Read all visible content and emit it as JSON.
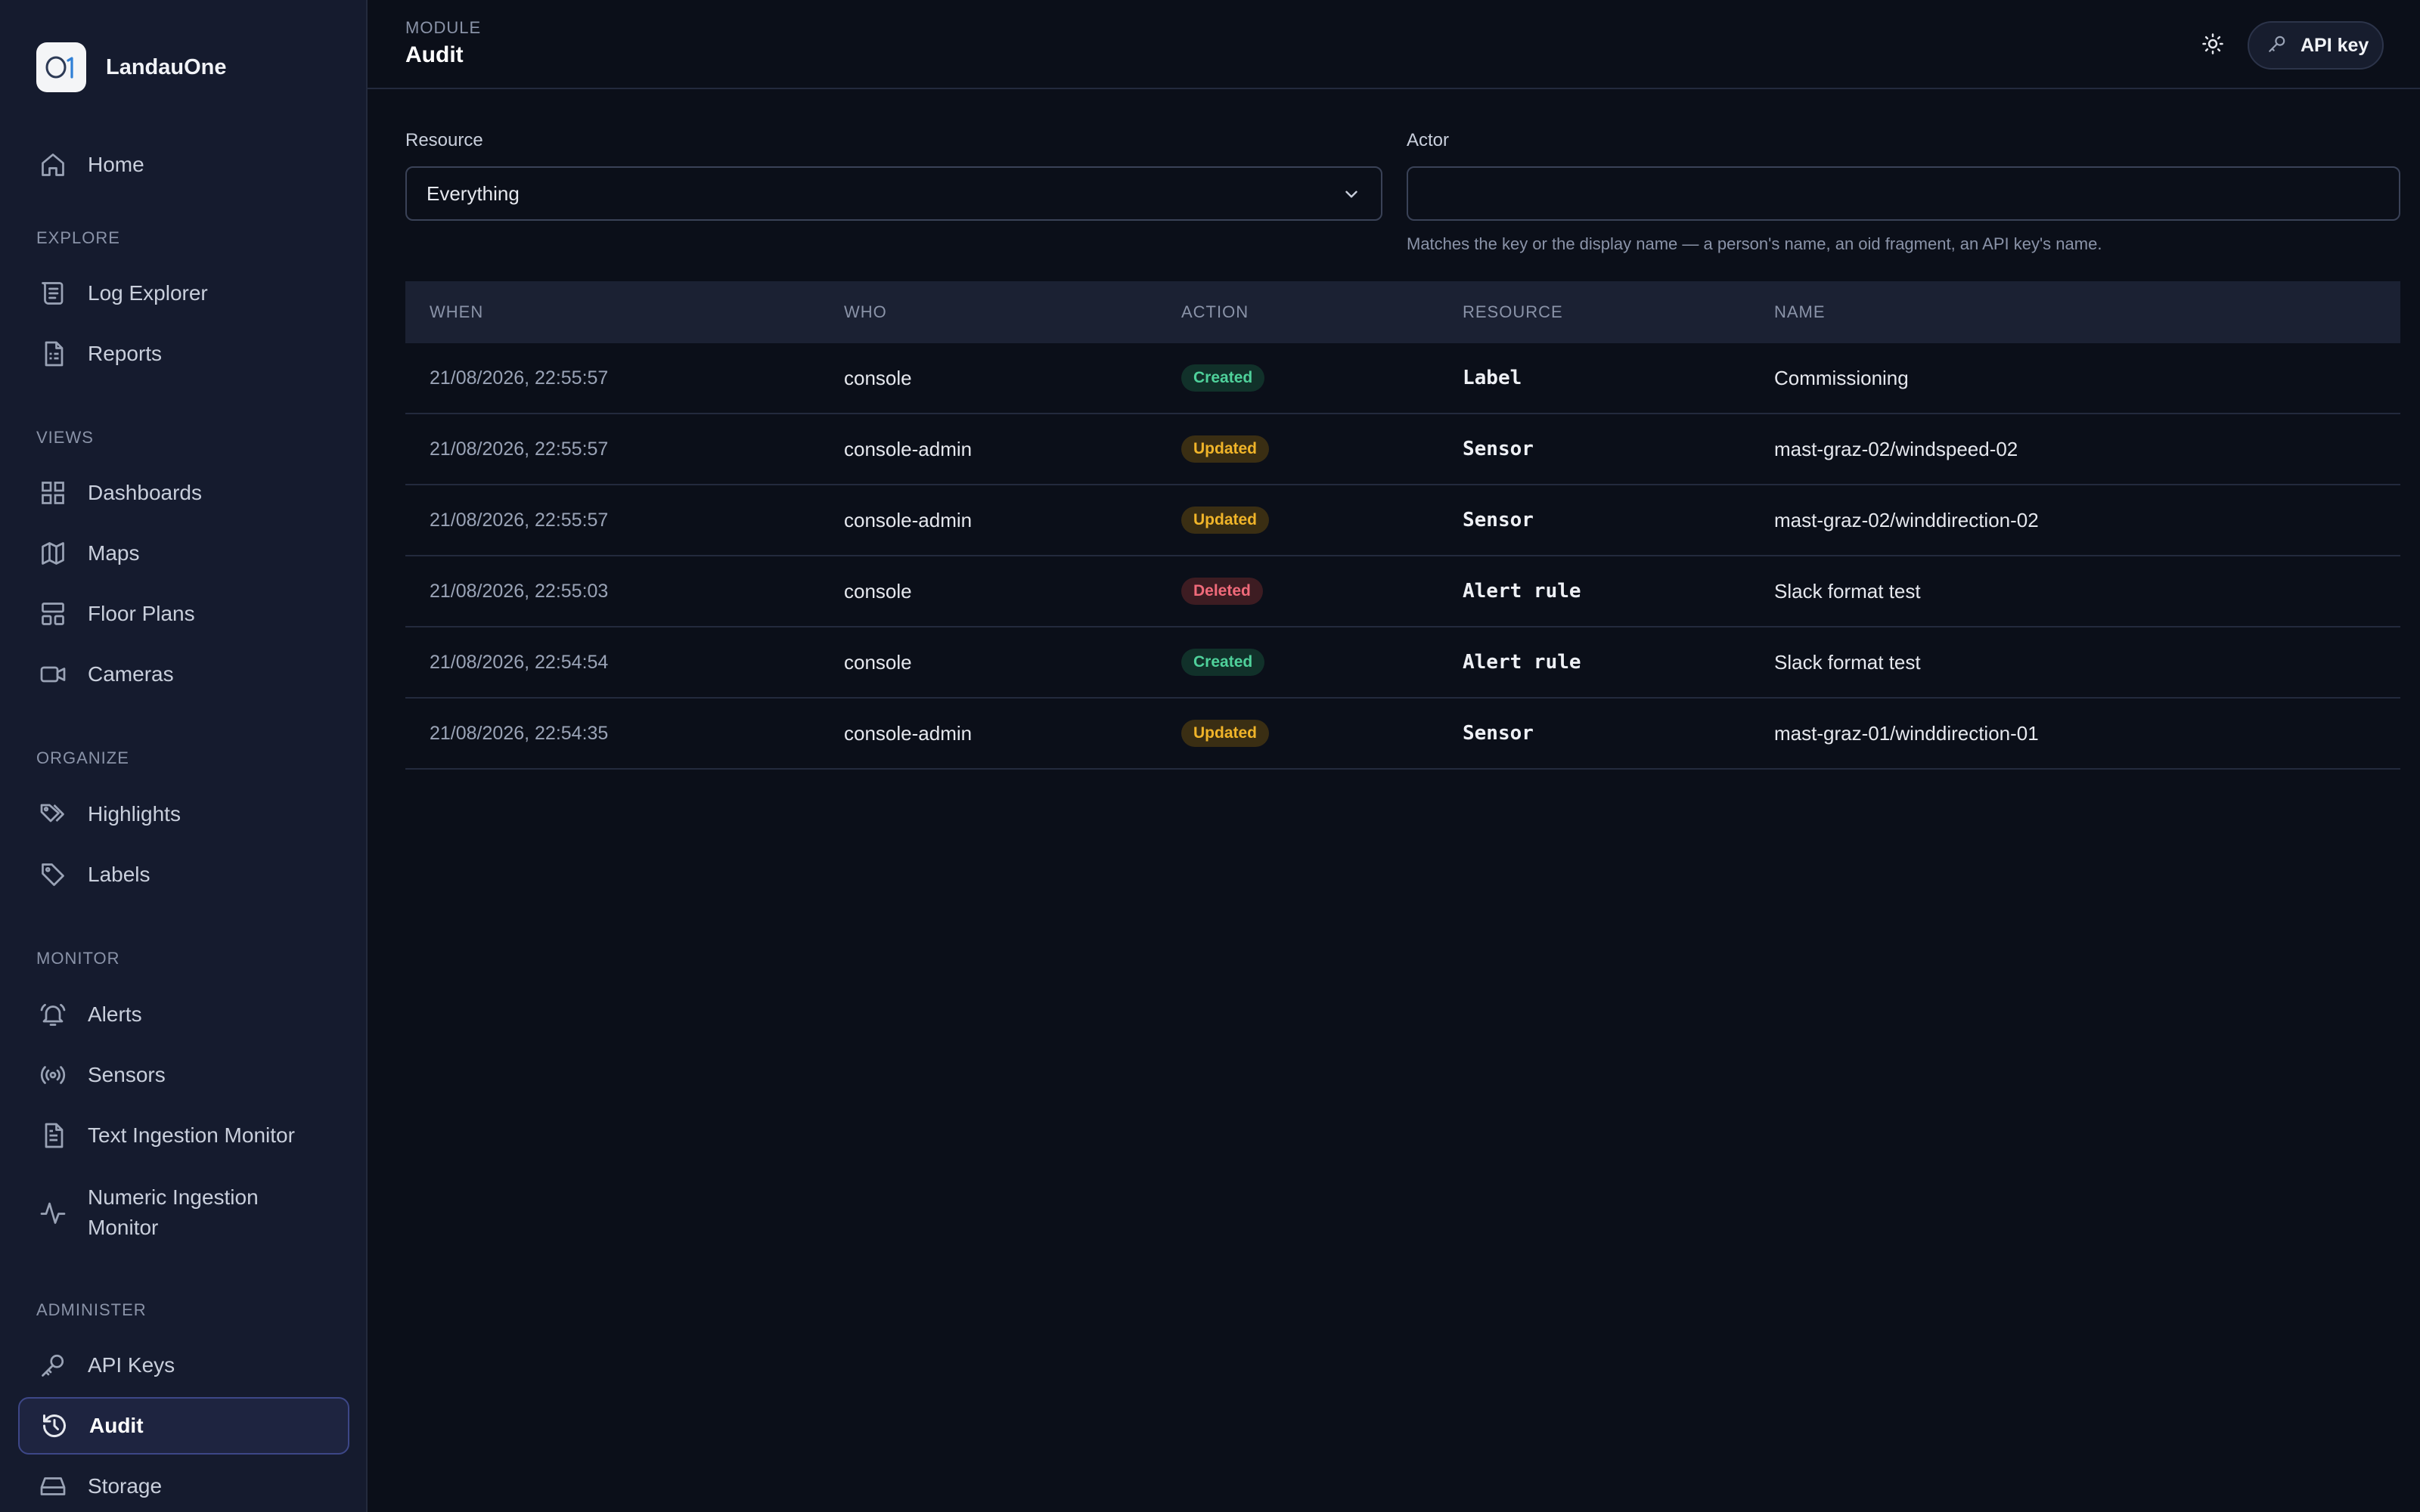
{
  "app": {
    "name": "LandauOne",
    "logo_text": "O1"
  },
  "header": {
    "module_label": "MODULE",
    "title": "Audit",
    "api_key_button": "API key"
  },
  "sidebar": {
    "home": "Home",
    "sections": {
      "explore": "EXPLORE",
      "views": "VIEWS",
      "organize": "ORGANIZE",
      "monitor": "MONITOR",
      "administer": "ADMINISTER"
    },
    "items": {
      "log_explorer": "Log Explorer",
      "reports": "Reports",
      "dashboards": "Dashboards",
      "maps": "Maps",
      "floor_plans": "Floor Plans",
      "cameras": "Cameras",
      "highlights": "Highlights",
      "labels": "Labels",
      "alerts": "Alerts",
      "sensors": "Sensors",
      "text_ingestion_monitor": "Text Ingestion Monitor",
      "numeric_ingestion_monitor_line1": "Numeric Ingestion",
      "numeric_ingestion_monitor_line2": "Monitor",
      "api_keys": "API Keys",
      "audit": "Audit",
      "storage": "Storage"
    },
    "active": "audit"
  },
  "filters": {
    "resource_label": "Resource",
    "resource_value": "Everything",
    "actor_label": "Actor",
    "actor_value": "",
    "actor_hint": "Matches the key or the display name — a person's name, an oid fragment, an API key's name."
  },
  "table": {
    "columns": {
      "when": "WHEN",
      "who": "WHO",
      "action": "ACTION",
      "resource": "RESOURCE",
      "name": "NAME"
    },
    "rows": [
      {
        "when": "21/08/2026, 22:55:57",
        "who": "console",
        "action": "Created",
        "resource": "Label",
        "name": "Commissioning"
      },
      {
        "when": "21/08/2026, 22:55:57",
        "who": "console-admin",
        "action": "Updated",
        "resource": "Sensor",
        "name": "mast-graz-02/windspeed-02"
      },
      {
        "when": "21/08/2026, 22:55:57",
        "who": "console-admin",
        "action": "Updated",
        "resource": "Sensor",
        "name": "mast-graz-02/winddirection-02"
      },
      {
        "when": "21/08/2026, 22:55:03",
        "who": "console",
        "action": "Deleted",
        "resource": "Alert rule",
        "name": "Slack format test"
      },
      {
        "when": "21/08/2026, 22:54:54",
        "who": "console",
        "action": "Created",
        "resource": "Alert rule",
        "name": "Slack format test"
      },
      {
        "when": "21/08/2026, 22:54:35",
        "who": "console-admin",
        "action": "Updated",
        "resource": "Sensor",
        "name": "mast-graz-01/winddirection-01"
      }
    ]
  },
  "colors": {
    "background": "#0b0f19",
    "sidebar": "#151b2e",
    "active_border": "#3d4787",
    "created": "#4fd19b",
    "updated": "#f0b429",
    "deleted": "#f06a7a"
  }
}
